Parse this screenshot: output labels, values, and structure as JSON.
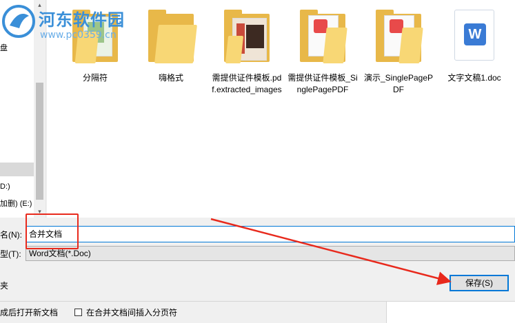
{
  "watermark": {
    "text": "河东软件园",
    "url": "www.pc0359.cn"
  },
  "nav": {
    "items": [
      {
        "label": "盘",
        "selected": false
      },
      {
        "label": "",
        "selected": true
      },
      {
        "label": "D:)",
        "selected": false
      },
      {
        "label": "加删) (E:)",
        "selected": false
      }
    ],
    "scroll_up": "▴",
    "scroll_down": "▾"
  },
  "files": [
    {
      "name": "分隔符",
      "kind": "folder-thumb"
    },
    {
      "name": "嗨格式",
      "kind": "folder"
    },
    {
      "name": "需提供证件模板.pdf.extracted_images",
      "kind": "folder-photo"
    },
    {
      "name": "需提供证件模板_SinglePagePDF",
      "kind": "folder-pdf"
    },
    {
      "name": "演示_SinglePagePDF",
      "kind": "folder-pdf"
    },
    {
      "name": "文字文稿1.doc",
      "kind": "word-doc"
    }
  ],
  "form": {
    "filename_label": "名(N):",
    "filename_value": "合并文档",
    "filetype_label": "型(T):",
    "filetype_value": "Word文档(*.Doc)",
    "hide_folders_label": "夹",
    "save_button": "保存(S)",
    "option_open_after": "成后打开新文档",
    "option_insert_pagebreak": "在合并文档间插入分页符"
  },
  "colors": {
    "annotation": "#e8291c",
    "accent": "#0078d7",
    "folder": "#f8d775",
    "pdf_badge": "#e84a4a",
    "word_badge": "#3a7bd5"
  }
}
